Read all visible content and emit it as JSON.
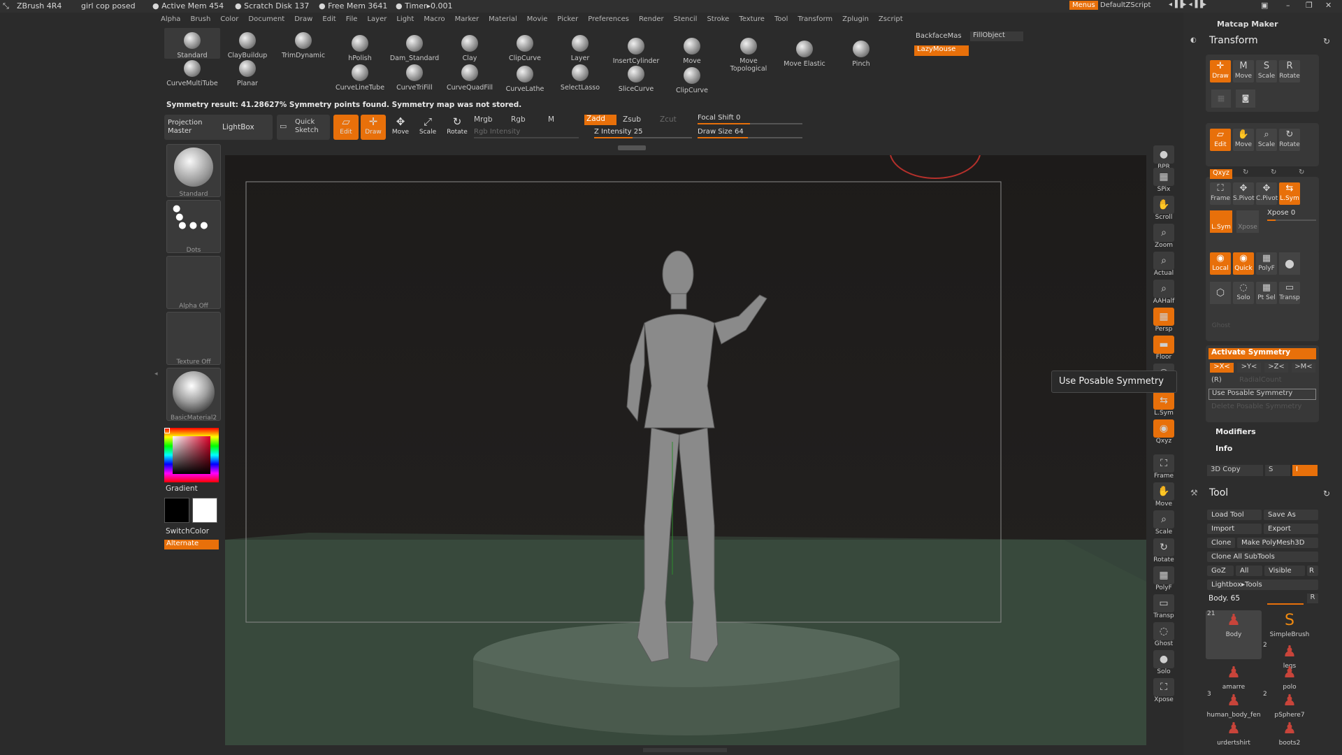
{
  "title_bar": {
    "app": "ZBrush 4R4",
    "document": "girl cop posed",
    "active_mem": "● Active Mem 454",
    "scratch": "● Scratch Disk 137",
    "free_mem": "● Free Mem 3641",
    "timer": "● Timer▸0.001",
    "menus_btn": "Menus",
    "script": "DefaultZScript"
  },
  "menu_items": [
    "Alpha",
    "Brush",
    "Color",
    "Document",
    "Draw",
    "Edit",
    "File",
    "Layer",
    "Light",
    "Macro",
    "Marker",
    "Material",
    "Movie",
    "Picker",
    "Preferences",
    "Render",
    "Stencil",
    "Stroke",
    "Texture",
    "Tool",
    "Transform",
    "Zplugin",
    "Zscript"
  ],
  "brushes": [
    "Standard",
    "ClayBuildup",
    "TrimDynamic",
    "hPolish",
    "Dam_Standard",
    "Clay",
    "ClipCurve",
    "Layer",
    "InsertCylinder",
    "Move",
    "Move Topological",
    "Move Elastic",
    "Pinch",
    "CurveMultiTube",
    "Planar",
    "CurveLineTube",
    "CurveTriFill",
    "CurveQuadFill",
    "CurveLathe",
    "SelectLasso",
    "SliceCurve",
    "ClipCurve"
  ],
  "top_right": {
    "backface": "BackfaceMas",
    "fill": "FillObject",
    "lazymouse": "LazyMouse"
  },
  "status": "Symmetry result: 41.28627% Symmetry points found. Symmetry map was not stored.",
  "toolbar": {
    "projection": "Projection Master",
    "lightbox": "LightBox",
    "quicksketch": "Quick Sketch",
    "edit": "Edit",
    "draw": "Draw",
    "move": "Move",
    "scale": "Scale",
    "rotate": "Rotate",
    "mrgb": "Mrgb",
    "rgb": "Rgb",
    "m": "M",
    "zadd": "Zadd",
    "zsub": "Zsub",
    "zcut": "Zcut",
    "rgb_intensity": "Rgb Intensity",
    "z_intensity": "Z Intensity 25",
    "focal_shift": "Focal Shift 0",
    "draw_size": "Draw Size 64"
  },
  "left_shelf": {
    "brush": "Standard",
    "stroke": "Dots",
    "alpha": "Alpha Off",
    "texture": "Texture Off",
    "material": "BasicMaterial2",
    "gradient": "Gradient",
    "switchcolor": "SwitchColor",
    "alternate": "Alternate"
  },
  "right_shelf": [
    "BPR",
    "SPix",
    "Scroll",
    "Zoom",
    "Actual",
    "AAHalf",
    "Persp",
    "Floor",
    "Local",
    "L.Sym",
    "Qxyz",
    "Frame",
    "Move",
    "Scale",
    "Rotate",
    "PolyF",
    "Transp",
    "Ghost",
    "Solo",
    "Xpose"
  ],
  "tooltip": "Use Posable Symmetry",
  "panel": {
    "matcap": "Matcap Maker",
    "transform_title": "Transform",
    "row1": [
      "Draw",
      "Move",
      "Scale",
      "Rotate"
    ],
    "row2": [
      "Edit",
      "Move",
      "Scale",
      "Rotate"
    ],
    "xyz": "Qxyz",
    "row3": [
      "Frame",
      "S.Pivot",
      "C.Pivot",
      "L.Sym"
    ],
    "lsym": "L.Sym",
    "xpose_btn": "Xpose",
    "xpose": "Xpose 0",
    "row4": [
      "Local",
      "Quick",
      "PolyF"
    ],
    "row5": [
      "Solo",
      "Pt Sel",
      "Transp"
    ],
    "ghost": "Ghost",
    "activate_sym": "Activate Symmetry",
    "sym_axes": [
      ">X<",
      ">Y<",
      ">Z<",
      ">M<"
    ],
    "r": "(R)",
    "radial": "RadialCount",
    "use_posable": "Use Posable Symmetry",
    "delete_posable": "Delete Posable Symmetry",
    "modifiers": "Modifiers",
    "info": "Info",
    "copy3d": "3D Copy",
    "s": "S",
    "i": "I",
    "tool_title": "Tool",
    "load": "Load Tool",
    "saveas": "Save As",
    "import": "Import",
    "export": "Export",
    "clone": "Clone",
    "make_poly": "Make PolyMesh3D",
    "clone_all": "Clone All SubTools",
    "goz": "GoZ",
    "all": "All",
    "visible": "Visible",
    "rbtn": "R",
    "lightbox_tools": "Lightbox▸Tools",
    "body": "Body. 65",
    "subtools": [
      {
        "name": "Body",
        "count": "21"
      },
      {
        "name": "SimpleBrush",
        "count": ""
      },
      {
        "name": "legs",
        "count": "2"
      },
      {
        "name": "amarre",
        "count": ""
      },
      {
        "name": "polo",
        "count": ""
      },
      {
        "name": "human_body_fen",
        "count": "3"
      },
      {
        "name": "pSphere7",
        "count": "2"
      },
      {
        "name": "urdertshirt",
        "count": ""
      },
      {
        "name": "boots2",
        "count": ""
      }
    ]
  },
  "colors": {
    "accent": "#e8700a",
    "bg": "#2b2b2b",
    "canvas": "#1f1d1c",
    "floor": "#3a4a38"
  }
}
